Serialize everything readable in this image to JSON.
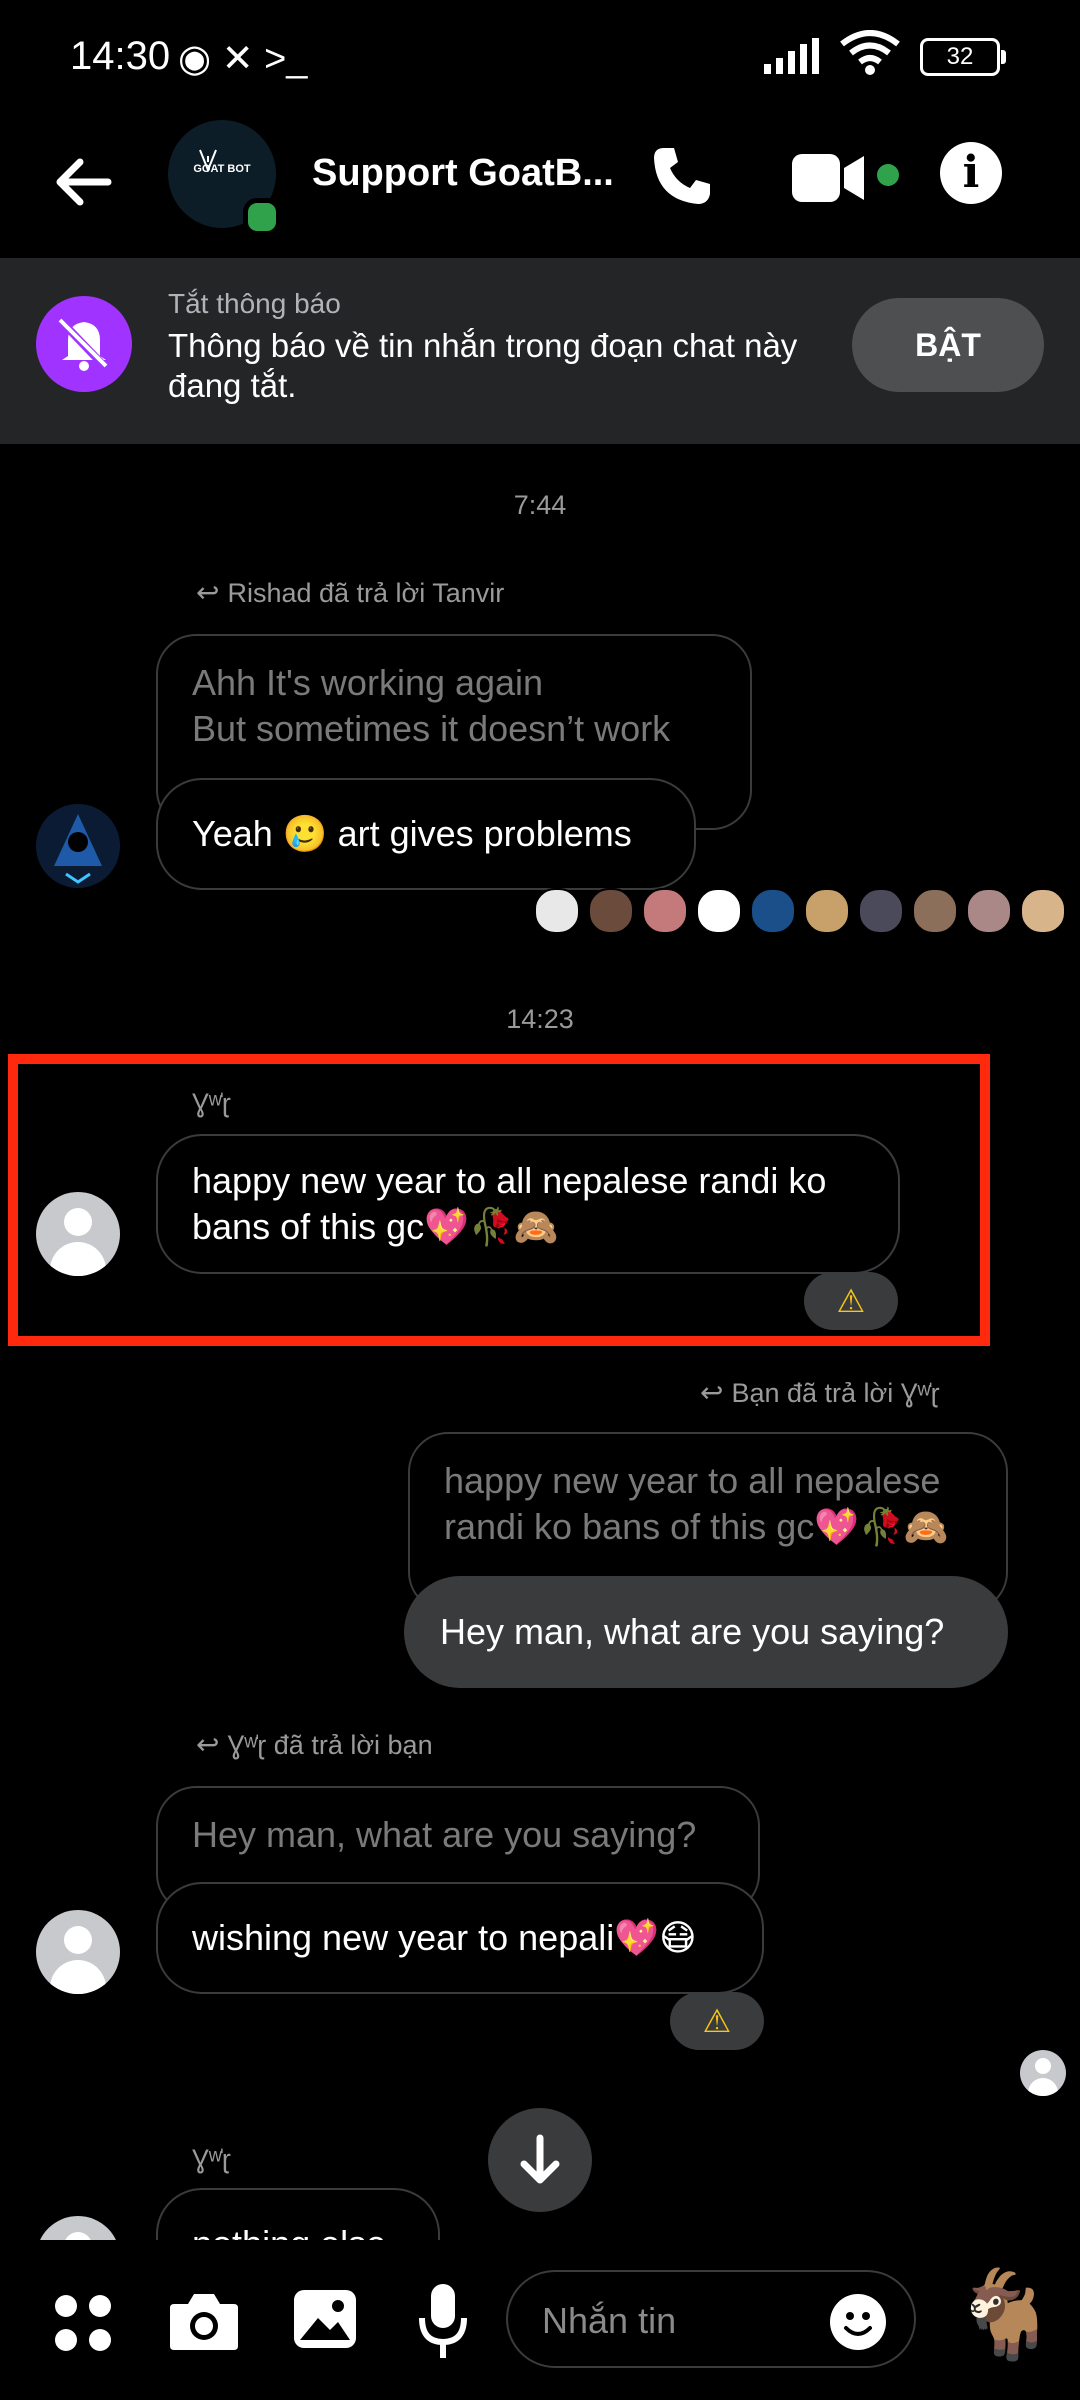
{
  "status_bar": {
    "time": "14:30",
    "icons_left": "◉ ✕ >_",
    "battery": "32"
  },
  "header": {
    "avatar_label": "GOAT BOT",
    "title": "Support GoatB..."
  },
  "banner": {
    "subtitle": "Tắt thông báo",
    "text": "Thông báo về tin nhắn trong đoạn chat này đang tắt.",
    "button": "BẬT"
  },
  "messages": {
    "ts1": "7:44",
    "reply1_label": "Rishad đã trả lời Tanvir",
    "reply1_quoted_line1": "Ahh It's working again",
    "reply1_quoted_line2": "But sometimes it doesn’t work",
    "reply1_text": "Yeah 🥲 art gives problems",
    "ts2": "14:23",
    "sender_name": "Ɣʷ̍ɽ",
    "msg2_text": "happy new year to all nepalese randi ko bans of this gc💖🥀🙈",
    "warn_icon": "⚠",
    "reply2_label": "Bạn đã trả lời Ɣʷ̍ɽ",
    "reply2_quoted": "happy new year to all nepalese randi ko bans of this gc💖🥀🙈",
    "reply2_text": "Hey man, what are you saying?",
    "reply3_label": "Ɣʷ̍ɽ đã trả lời bạn",
    "reply3_quoted": "Hey man, what are you saying?",
    "reply3_text": "wishing new year to nepali💖😷",
    "sender_name2": "Ɣʷ̍ɽ",
    "msg_partial": "nothing else"
  },
  "composer": {
    "placeholder": "Nhắn tin"
  },
  "colors": {
    "accent_purple": "#a033ff",
    "online_green": "#31a24c",
    "highlight_red": "#ff2a0d",
    "bubble_gray": "#3a3b3c"
  },
  "seen_avatar_colors": [
    "#e8e8e8",
    "#6b4b3c",
    "#c47a7a",
    "#ffffff",
    "#1b4f8a",
    "#c8a06a",
    "#4a4a5a",
    "#8b6f5a",
    "#a88",
    "#d8b48a"
  ]
}
